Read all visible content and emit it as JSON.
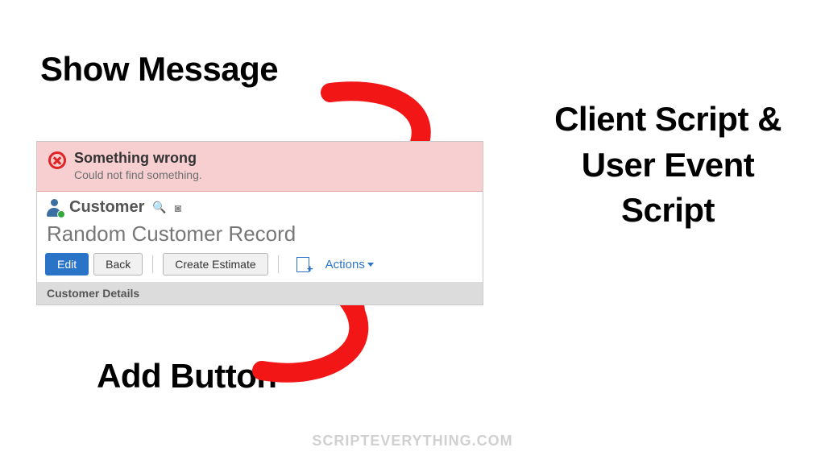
{
  "callouts": {
    "show_message": "Show Message",
    "add_button": "Add Button"
  },
  "side_title": "Client Script & User Event Script",
  "watermark": "SCRIPTEVERYTHING.COM",
  "alert": {
    "title": "Something wrong",
    "subtitle": "Could not find something."
  },
  "record": {
    "type": "Customer",
    "title": "Random Customer Record",
    "buttons": {
      "edit": "Edit",
      "back": "Back",
      "create_estimate": "Create Estimate"
    },
    "actions_label": "Actions",
    "section_label": "Customer Details"
  },
  "colors": {
    "primary": "#2a74c7",
    "alert_bg": "#f7cfd1",
    "danger": "#e02424",
    "arrow": "#f21616"
  }
}
